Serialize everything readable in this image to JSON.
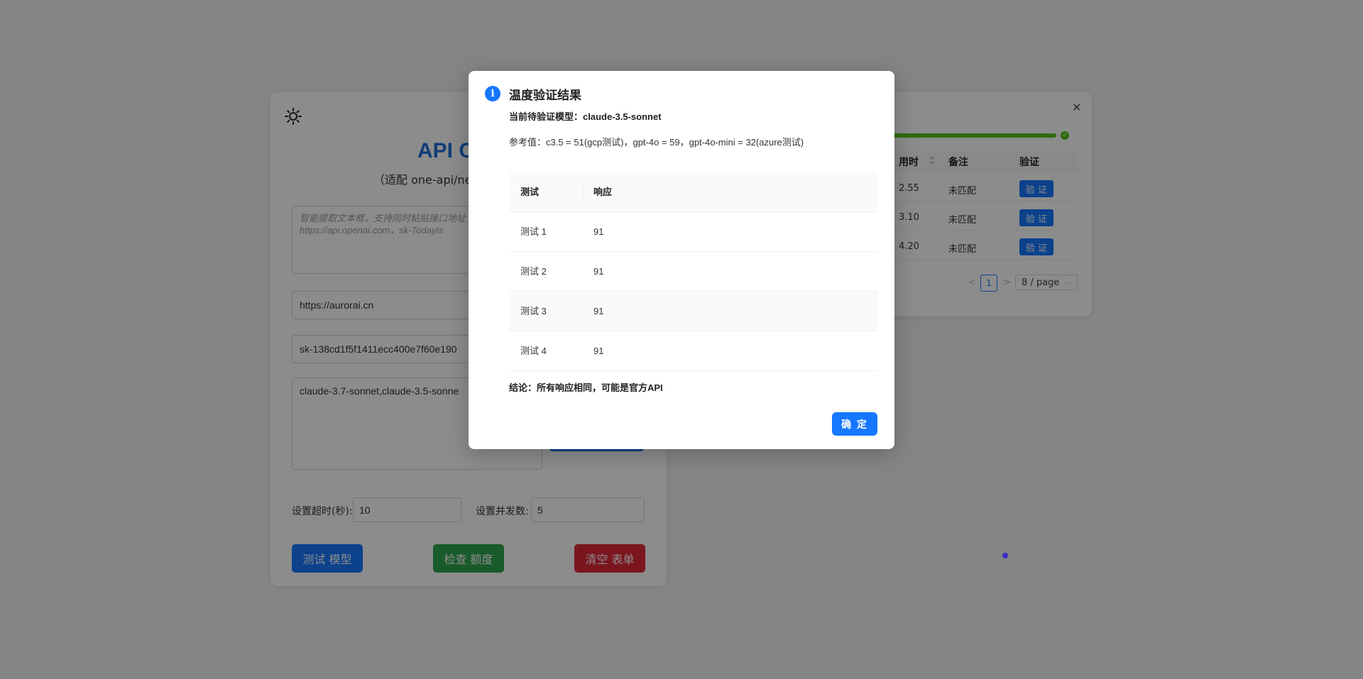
{
  "main": {
    "title": "API C",
    "subtitle": "（适配 one-api/new",
    "extract_placeholder": "智能提取文本框，支持同时粘贴接口地址 https://api.openai.com，sk-TodayIs",
    "api_url": "https://aurorai.cn",
    "api_key": "sk-138cd1f5f1411ecc400e7f60e190",
    "models": "claude-3.7-sonnet,claude-3.5-sonne",
    "timeout_label": "设置超时(秒):",
    "timeout_value": "10",
    "concurrency_label": "设置并发数:",
    "concurrency_value": "5",
    "buttons": {
      "test": "测试 模型",
      "quota": "检查 额度",
      "clear": "清空 表单"
    }
  },
  "results": {
    "close": "×",
    "progress": 1.0,
    "headers": {
      "time": "用时",
      "note": "备注",
      "verify": "验证"
    },
    "rows": [
      {
        "time": "2.55",
        "note": "未匹配",
        "verify": "验 证"
      },
      {
        "time": "3.10",
        "note": "未匹配",
        "verify": "验 证"
      },
      {
        "time": "4.20",
        "note": "未匹配",
        "verify": "验 证"
      }
    ],
    "pager": {
      "prev": "<",
      "page": "1",
      "next": ">",
      "page_size": "8 / page"
    }
  },
  "modal": {
    "icon": "info-icon",
    "title": "温度验证结果",
    "model_line": "当前待验证模型：claude-3.5-sonnet",
    "reference_line": "参考值：c3.5 = 51(gcp测试)，gpt-4o = 59，gpt-4o-mini = 32(azure测试)",
    "table_headers": {
      "test": "测试",
      "response": "响应"
    },
    "table_rows": [
      {
        "test": "测试 1",
        "response": "91"
      },
      {
        "test": "测试 2",
        "response": "91"
      },
      {
        "test": "测试 3",
        "response": "91"
      },
      {
        "test": "测试 4",
        "response": "91"
      }
    ],
    "conclusion": "结论：所有响应相同，可能是官方API",
    "ok": "确 定"
  },
  "colors": {
    "primary": "#1677ff",
    "success": "#2ea44f",
    "danger": "#e0283a",
    "progress": "#52c41a"
  }
}
